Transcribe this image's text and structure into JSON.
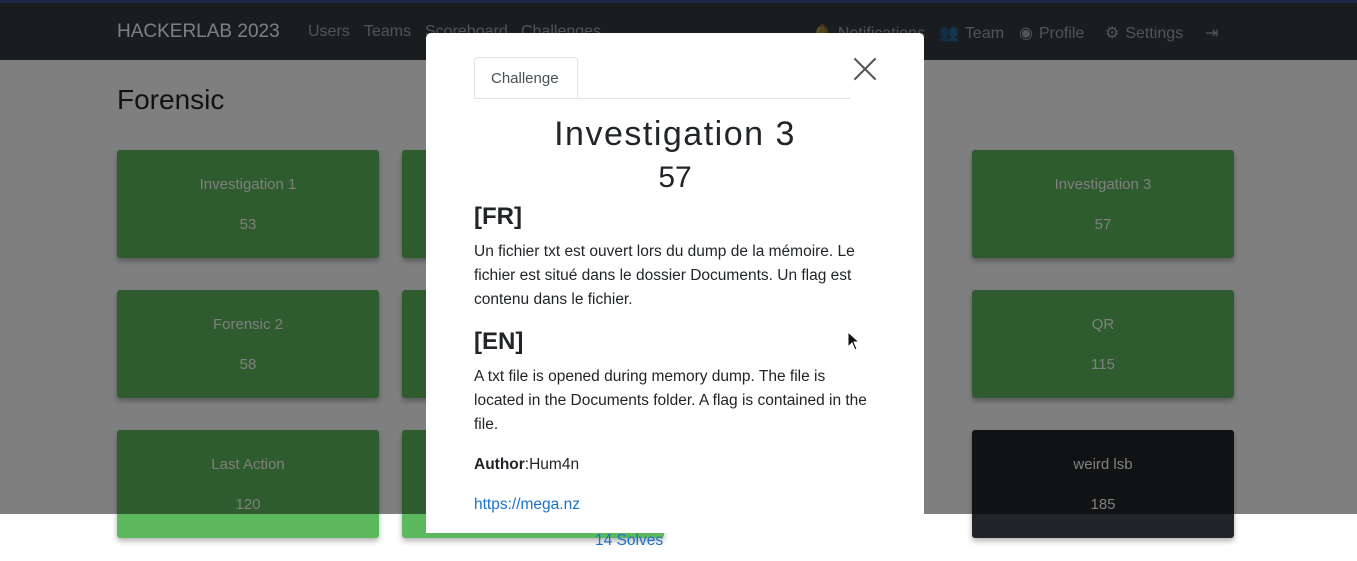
{
  "navbar": {
    "brand": "HACKERLAB 2023",
    "links": [
      {
        "label": "Users"
      },
      {
        "label": "Teams"
      },
      {
        "label": "Scoreboard"
      },
      {
        "label": "Challenges"
      }
    ],
    "right": [
      {
        "label": "Notifications",
        "icon": "bell-icon"
      },
      {
        "label": "Team",
        "icon": "users-icon"
      },
      {
        "label": "Profile",
        "icon": "user-circle-icon"
      },
      {
        "label": "Settings",
        "icon": "cogs-icon"
      },
      {
        "label": "",
        "icon": "logout-icon"
      }
    ]
  },
  "page": {
    "title": "Forensic"
  },
  "cards": [
    {
      "name": "Investigation 1",
      "points": "53",
      "solved": true
    },
    {
      "name": "Investigation 3",
      "points": "57",
      "solved": true
    },
    {
      "name": "Forensic 2",
      "points": "58",
      "solved": true
    },
    {
      "name": "QR",
      "points": "115",
      "solved": true
    },
    {
      "name": "Last Action",
      "points": "120",
      "solved": true
    },
    {
      "name": "weird lsb",
      "points": "185",
      "solved": false
    }
  ],
  "modal": {
    "tabs": {
      "challenge": "Challenge",
      "solves": "14 Solves"
    },
    "title": "Investigation 3",
    "value": "57",
    "fr_heading": "[FR]",
    "fr_text": "Un fichier txt est ouvert lors du dump de la mémoire. Le fichier est situé dans le dossier Documents. Un flag est contenu dans le fichier.",
    "en_heading": "[EN]",
    "en_text": "A txt file is opened during memory dump. The file is located in the Documents folder. A flag is contained in the file.",
    "author_label": "Author",
    "author_value": ":Hum4n",
    "link": "https://mega.nz"
  },
  "colors": {
    "navbar": "#343a40",
    "solved_card": "#5cb85c",
    "unsolved_card": "#212529",
    "link": "#1a73c8"
  }
}
